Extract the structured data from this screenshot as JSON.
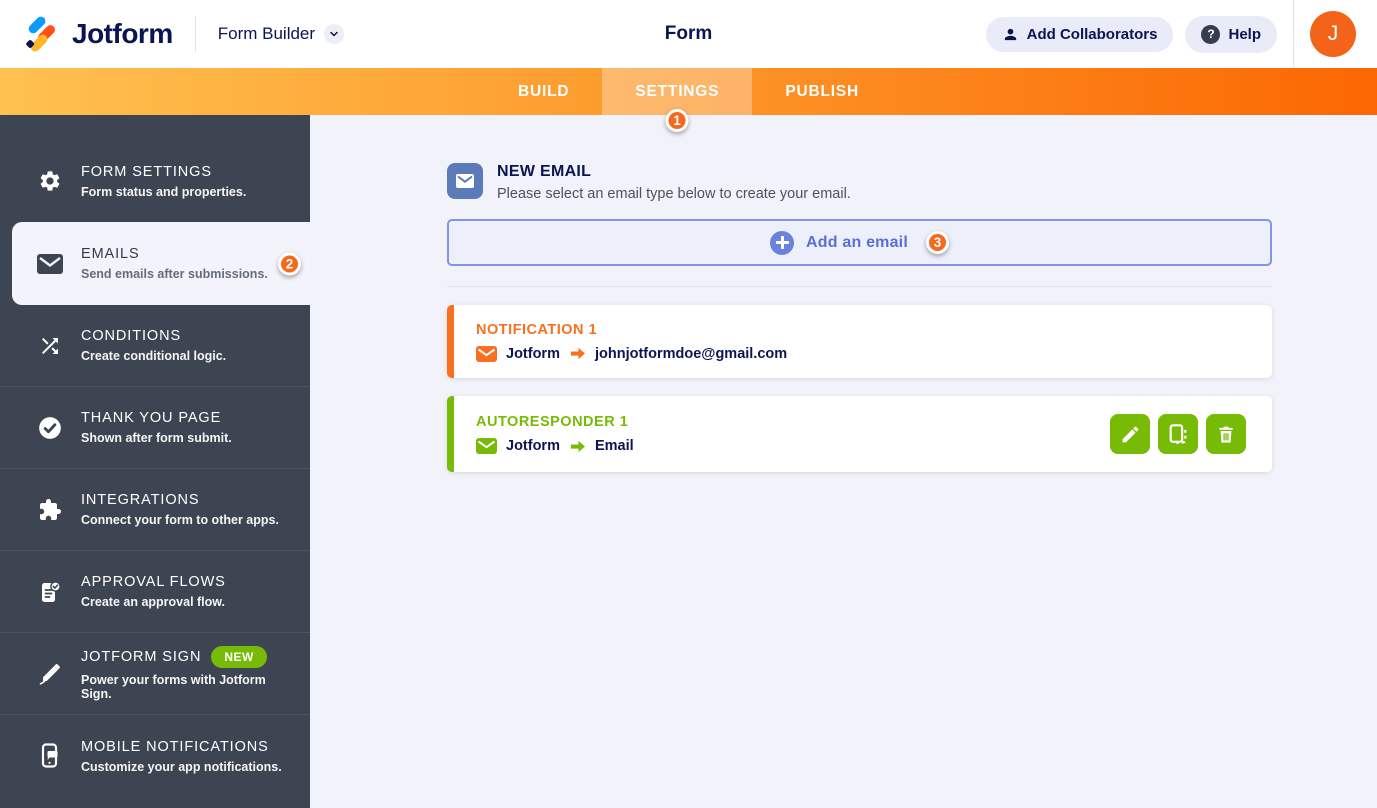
{
  "colors": {
    "brand_navy": "#0a1551",
    "tabbar_gradient_left": "#ffc14f",
    "tabbar_gradient_right": "#fc6702",
    "badge_orange": "#f5681d",
    "notification_orange": "#f8701f",
    "autoresponder_green": "#78bb07",
    "add_email_periwinkle": "#5a6fd6",
    "new_email_icon_blue": "#5a7ab8",
    "sidebar_bg": "#3d4452",
    "content_bg": "#f2f2fa",
    "avatar_orange": "#f4631a"
  },
  "header": {
    "logo_text": "Jotform",
    "product_label": "Form Builder",
    "title": "Form",
    "add_collaborators_label": "Add Collaborators",
    "help_label": "Help",
    "help_glyph": "?",
    "avatar_initial": "J"
  },
  "tabs": [
    {
      "label": "BUILD",
      "active": false
    },
    {
      "label": "SETTINGS",
      "active": true,
      "badge": "1"
    },
    {
      "label": "PUBLISH",
      "active": false
    }
  ],
  "sidebar": {
    "items": [
      {
        "icon": "gear-icon",
        "title": "FORM SETTINGS",
        "subtitle": "Form status and properties."
      },
      {
        "icon": "envelope-icon",
        "title": "EMAILS",
        "subtitle": "Send emails after submissions.",
        "selected": true,
        "badge": "2"
      },
      {
        "icon": "shuffle-icon",
        "title": "CONDITIONS",
        "subtitle": "Create conditional logic."
      },
      {
        "icon": "check-circle-icon",
        "title": "THANK YOU PAGE",
        "subtitle": "Shown after form submit."
      },
      {
        "icon": "puzzle-icon",
        "title": "INTEGRATIONS",
        "subtitle": "Connect your form to other apps."
      },
      {
        "icon": "document-check-icon",
        "title": "APPROVAL FLOWS",
        "subtitle": "Create an approval flow."
      },
      {
        "icon": "pen-icon",
        "title": "JOTFORM SIGN",
        "subtitle": "Power your forms with Jotform Sign.",
        "tag": "NEW"
      },
      {
        "icon": "mobile-icon",
        "title": "MOBILE NOTIFICATIONS",
        "subtitle": "Customize your app notifications."
      }
    ]
  },
  "main": {
    "section": {
      "title": "NEW EMAIL",
      "subtitle": "Please select an email type below to create your email."
    },
    "add_email": {
      "label": "Add an email",
      "badge": "3"
    },
    "emails": [
      {
        "type": "notification",
        "title": "NOTIFICATION 1",
        "from": "Jotform",
        "to": "johnjotformdoe@gmail.com"
      },
      {
        "type": "autoresponder",
        "title": "AUTORESPONDER 1",
        "from": "Jotform",
        "to": "Email",
        "actions": [
          "edit",
          "duplicate",
          "delete"
        ]
      }
    ]
  }
}
